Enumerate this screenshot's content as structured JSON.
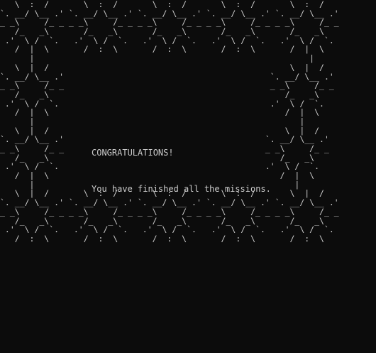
{
  "terminal": {
    "background": "#0c0c0c",
    "foreground": "#cccccc",
    "ascii_border_lines": [
      "   \\  :  /       \\  :  /       \\  :  /       \\  :  /       \\  :  /",
      "`. __/ \\__ .' `. __/ \\__ .' `. __/ \\__ .' `. __/ \\__ .' `. __/ \\__ .'",
      "_ _\\     /_ _ _ _\\     /_ _ _ _\\     /_ _ _ _\\     /_ _ _ _\\     /_ _",
      "   /_   _\\       /_   _\\       /_   _\\       /_   _\\       /_   _\\",
      " .'  \\ /  `.   .'  \\ /  `.   .'  \\ /  `.   .'  \\ /  `.   .'  \\ /  `.",
      "   /  |  \\       /  :  \\       /  :  \\       /  :  \\       /  |  \\",
      "      |                                                        |",
      "   \\  |  /                                                 \\  |  /",
      "`. __/ \\__ .'                                          `. __/ \\__ .'",
      "_ _\\     /_ _                                          _ _\\     /_ _",
      "   /_   _\\                                                /_   _\\",
      " .'  \\ /  `.                                           .'  \\ /  `.",
      "   /  |  \\                                                /  |  \\",
      "      |                                                      |",
      "   \\  |  /                                                \\  |  /",
      "`. __/ \\__ .'                                         `. __/ \\__ .'",
      "_ _\\     /_ _                                         _ _\\     /_ _",
      "   /_   _\\                                               /_   _\\",
      " .'  \\ /  `.                                          .'  \\ /  `.",
      "   /  |  \\                                               /  |  \\",
      "      |                                                     |",
      "   \\  |  /       \\  :  /       \\  :  /       \\  :  /       \\  |  /",
      "`. __/ \\__ .' `. __/ \\__ .' `. __/ \\__ .' `. __/ \\__ .' `. __/ \\__ .'",
      "_ _\\     /_ _ _ _\\     /_ _ _ _\\     /_ _ _ _\\     /_ _ _ _\\     /_ _",
      "   /_   _\\       /_   _\\       /_   _\\       /_   _\\       /_   _\\",
      " .'  \\ /  `.   .'  \\ /  `.   .'  \\ /  `.   .'  \\ /  `.   .'  \\ /  `.",
      "   /  :  \\       /  :  \\       /  :  \\       /  :  \\       /  :  \\"
    ]
  },
  "message": {
    "title": "CONGRATULATIONS!",
    "body": "You have finished all the missions."
  }
}
